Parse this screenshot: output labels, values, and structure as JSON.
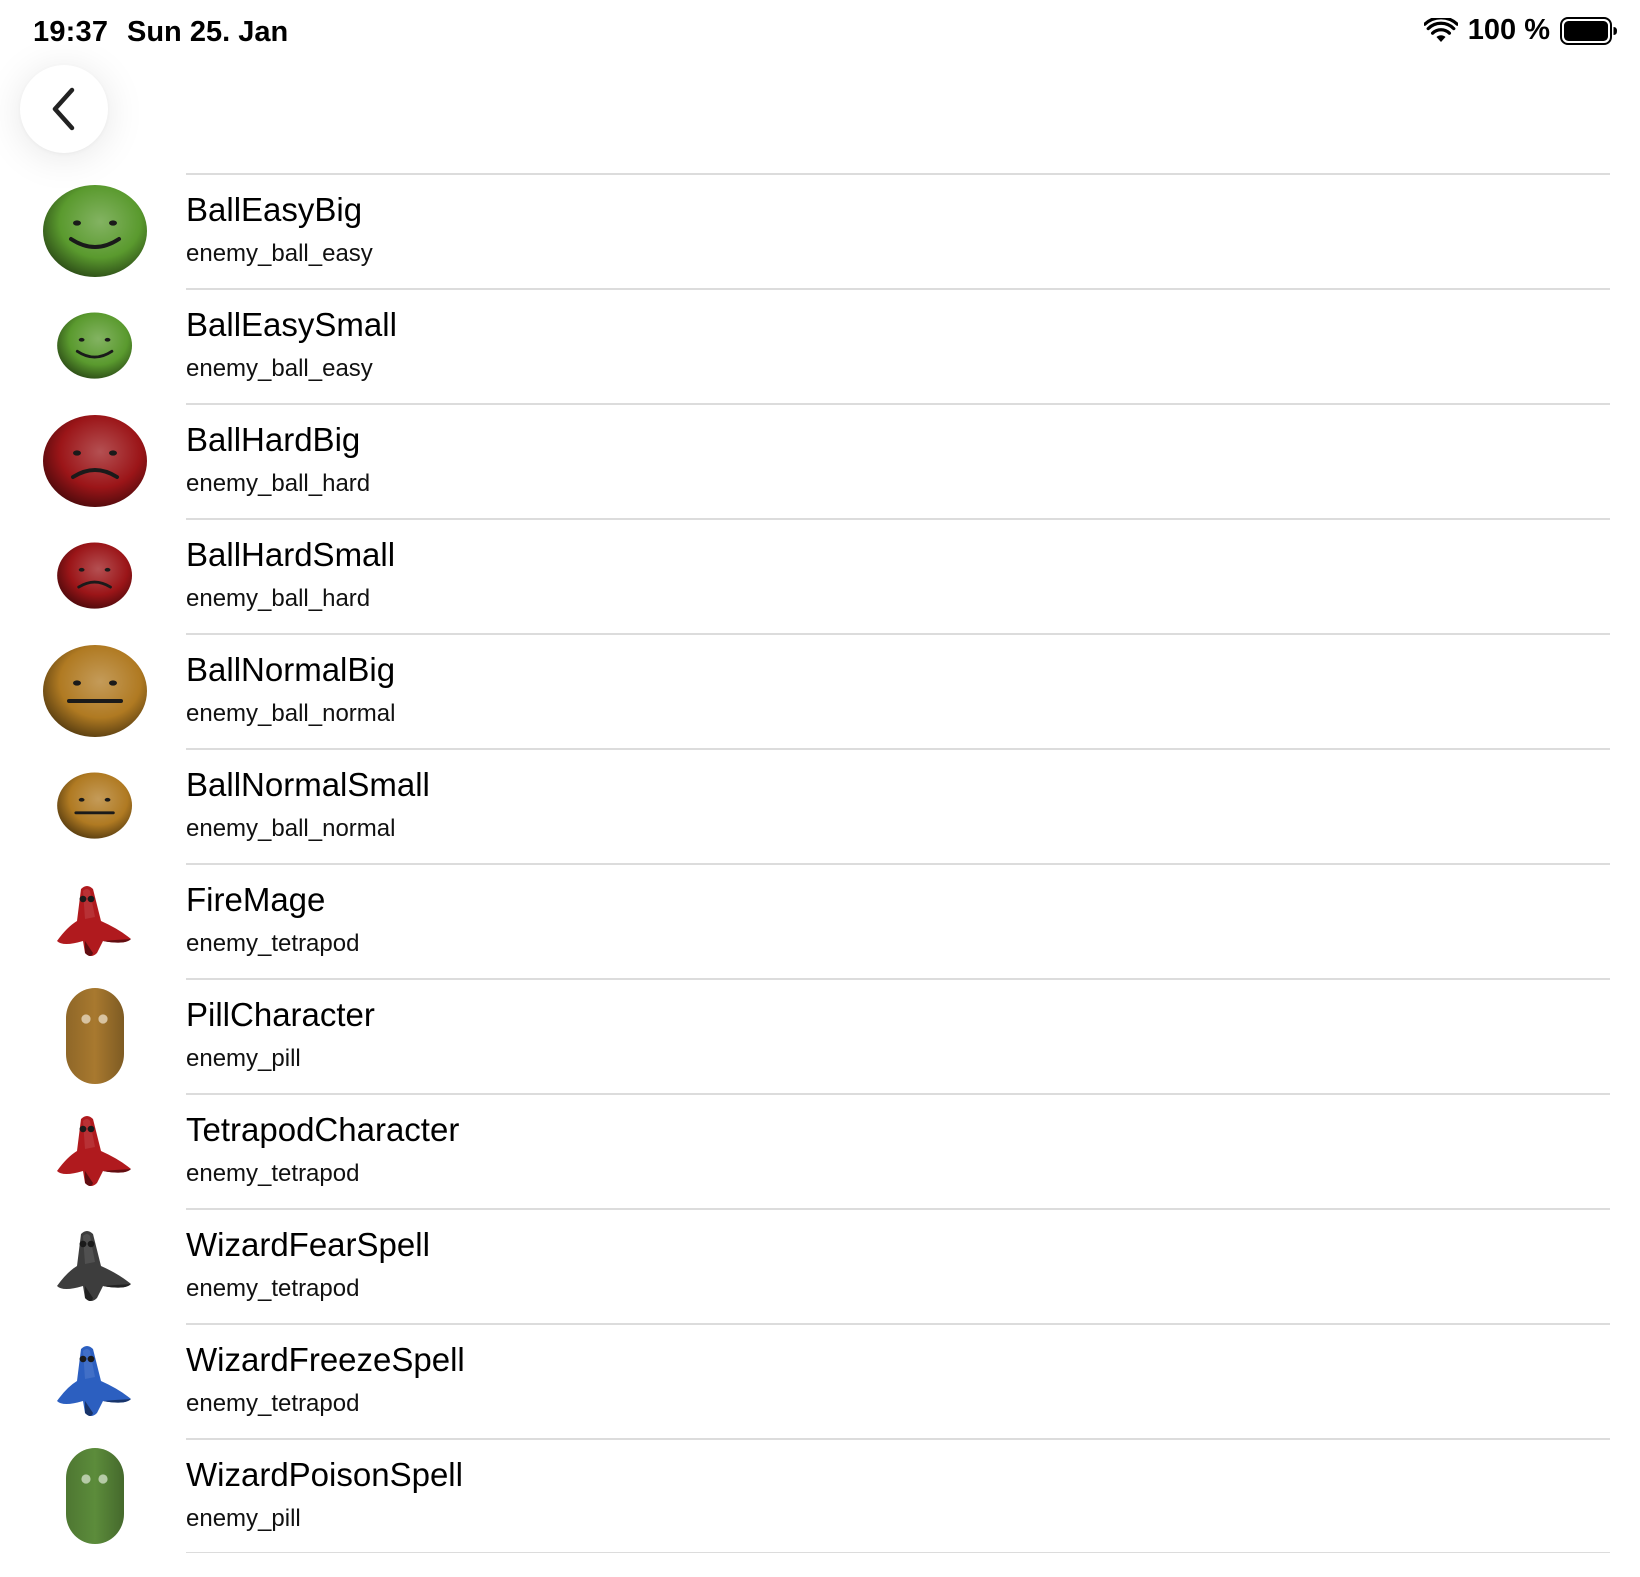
{
  "status_bar": {
    "time": "19:37",
    "date": "Sun 25. Jan",
    "battery_percent": "100 %",
    "icons": [
      "wifi-icon",
      "battery-icon"
    ]
  },
  "nav": {
    "back_icon": "chevron-left-icon"
  },
  "items": [
    {
      "title": "BallEasyBig",
      "subtitle": "enemy_ball_easy",
      "icon": "green-smiling-ball-icon",
      "color": "#5a9a2e"
    },
    {
      "title": "BallEasySmall",
      "subtitle": "enemy_ball_easy",
      "icon": "green-smiling-ball-icon",
      "color": "#5a9a2e"
    },
    {
      "title": "BallHardBig",
      "subtitle": "enemy_ball_hard",
      "icon": "red-frowning-ball-icon",
      "color": "#9b1518"
    },
    {
      "title": "BallHardSmall",
      "subtitle": "enemy_ball_hard",
      "icon": "red-frowning-ball-icon",
      "color": "#9b1518"
    },
    {
      "title": "BallNormalBig",
      "subtitle": "enemy_ball_normal",
      "icon": "orange-neutral-ball-icon",
      "color": "#b07a22"
    },
    {
      "title": "BallNormalSmall",
      "subtitle": "enemy_ball_normal",
      "icon": "orange-neutral-ball-icon",
      "color": "#b07a22"
    },
    {
      "title": "FireMage",
      "subtitle": "enemy_tetrapod",
      "icon": "red-tetrapod-icon",
      "color": "#b01a1e"
    },
    {
      "title": "PillCharacter",
      "subtitle": "enemy_pill",
      "icon": "orange-pill-icon",
      "color": "#a8792f"
    },
    {
      "title": "TetrapodCharacter",
      "subtitle": "enemy_tetrapod",
      "icon": "red-tetrapod-icon",
      "color": "#b01a1e"
    },
    {
      "title": "WizardFearSpell",
      "subtitle": "enemy_tetrapod",
      "icon": "gray-tetrapod-icon",
      "color": "#3d3d3d"
    },
    {
      "title": "WizardFreezeSpell",
      "subtitle": "enemy_tetrapod",
      "icon": "blue-tetrapod-icon",
      "color": "#2c5fc0"
    },
    {
      "title": "WizardPoisonSpell",
      "subtitle": "enemy_pill",
      "icon": "green-pill-icon",
      "color": "#5c8c3b"
    }
  ]
}
